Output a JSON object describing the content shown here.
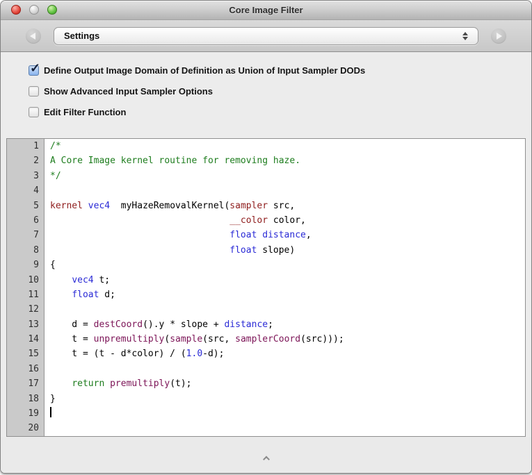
{
  "window": {
    "title": "Core Image Filter"
  },
  "toolbar": {
    "selected_page": "Settings"
  },
  "options": [
    {
      "label": "Define Output Image Domain of Definition as Union of Input Sampler DODs",
      "checked": true
    },
    {
      "label": "Show Advanced Input Sampler Options",
      "checked": false
    },
    {
      "label": "Edit Filter Function",
      "checked": false
    }
  ],
  "editor": {
    "colors": {
      "comment": "#1e7d1e",
      "control": "#1e7d1e",
      "keyword": "#8f1d1d",
      "type": "#2a2ad6",
      "builtin": "#7c1457",
      "plain": "#000000"
    },
    "lines": [
      {
        "no": 1,
        "tokens": [
          [
            "cmt",
            "/*"
          ]
        ]
      },
      {
        "no": 2,
        "tokens": [
          [
            "cmt",
            "A Core Image kernel routine for removing haze."
          ]
        ]
      },
      {
        "no": 3,
        "tokens": [
          [
            "cmt",
            "*/"
          ]
        ]
      },
      {
        "no": 4,
        "tokens": []
      },
      {
        "no": 5,
        "tokens": [
          [
            "kw",
            "kernel"
          ],
          [
            "plain",
            " "
          ],
          [
            "type",
            "vec4"
          ],
          [
            "plain",
            "  myHazeRemovalKernel("
          ],
          [
            "kw",
            "sampler"
          ],
          [
            "plain",
            " src,"
          ]
        ]
      },
      {
        "no": 6,
        "tokens": [
          [
            "plain",
            "                                 "
          ],
          [
            "kw",
            "__color"
          ],
          [
            "plain",
            " color,"
          ]
        ]
      },
      {
        "no": 7,
        "tokens": [
          [
            "plain",
            "                                 "
          ],
          [
            "type",
            "float"
          ],
          [
            "plain",
            " "
          ],
          [
            "type",
            "distance"
          ],
          [
            "plain",
            ","
          ]
        ]
      },
      {
        "no": 8,
        "tokens": [
          [
            "plain",
            "                                 "
          ],
          [
            "type",
            "float"
          ],
          [
            "plain",
            " slope)"
          ]
        ]
      },
      {
        "no": 9,
        "tokens": [
          [
            "plain",
            "{"
          ]
        ]
      },
      {
        "no": 10,
        "tokens": [
          [
            "plain",
            "    "
          ],
          [
            "type",
            "vec4"
          ],
          [
            "plain",
            " t;"
          ]
        ]
      },
      {
        "no": 11,
        "tokens": [
          [
            "plain",
            "    "
          ],
          [
            "type",
            "float"
          ],
          [
            "plain",
            " d;"
          ]
        ]
      },
      {
        "no": 12,
        "tokens": []
      },
      {
        "no": 13,
        "tokens": [
          [
            "plain",
            "    d = "
          ],
          [
            "fn",
            "destCoord"
          ],
          [
            "plain",
            "().y * slope + "
          ],
          [
            "type",
            "distance"
          ],
          [
            "plain",
            ";"
          ]
        ]
      },
      {
        "no": 14,
        "tokens": [
          [
            "plain",
            "    t = "
          ],
          [
            "fn",
            "unpremultiply"
          ],
          [
            "plain",
            "("
          ],
          [
            "fn",
            "sample"
          ],
          [
            "plain",
            "(src, "
          ],
          [
            "fn",
            "samplerCoord"
          ],
          [
            "plain",
            "(src)));"
          ]
        ]
      },
      {
        "no": 15,
        "tokens": [
          [
            "plain",
            "    t = (t - d*color) / ("
          ],
          [
            "type",
            "1.0"
          ],
          [
            "plain",
            "-d);"
          ]
        ]
      },
      {
        "no": 16,
        "tokens": []
      },
      {
        "no": 17,
        "tokens": [
          [
            "plain",
            "    "
          ],
          [
            "ctrl",
            "return"
          ],
          [
            "plain",
            " "
          ],
          [
            "fn",
            "premultiply"
          ],
          [
            "plain",
            "(t);"
          ]
        ]
      },
      {
        "no": 18,
        "tokens": [
          [
            "plain",
            "}"
          ]
        ]
      },
      {
        "no": 19,
        "tokens": [],
        "caret": true
      },
      {
        "no": 20,
        "tokens": []
      }
    ]
  }
}
